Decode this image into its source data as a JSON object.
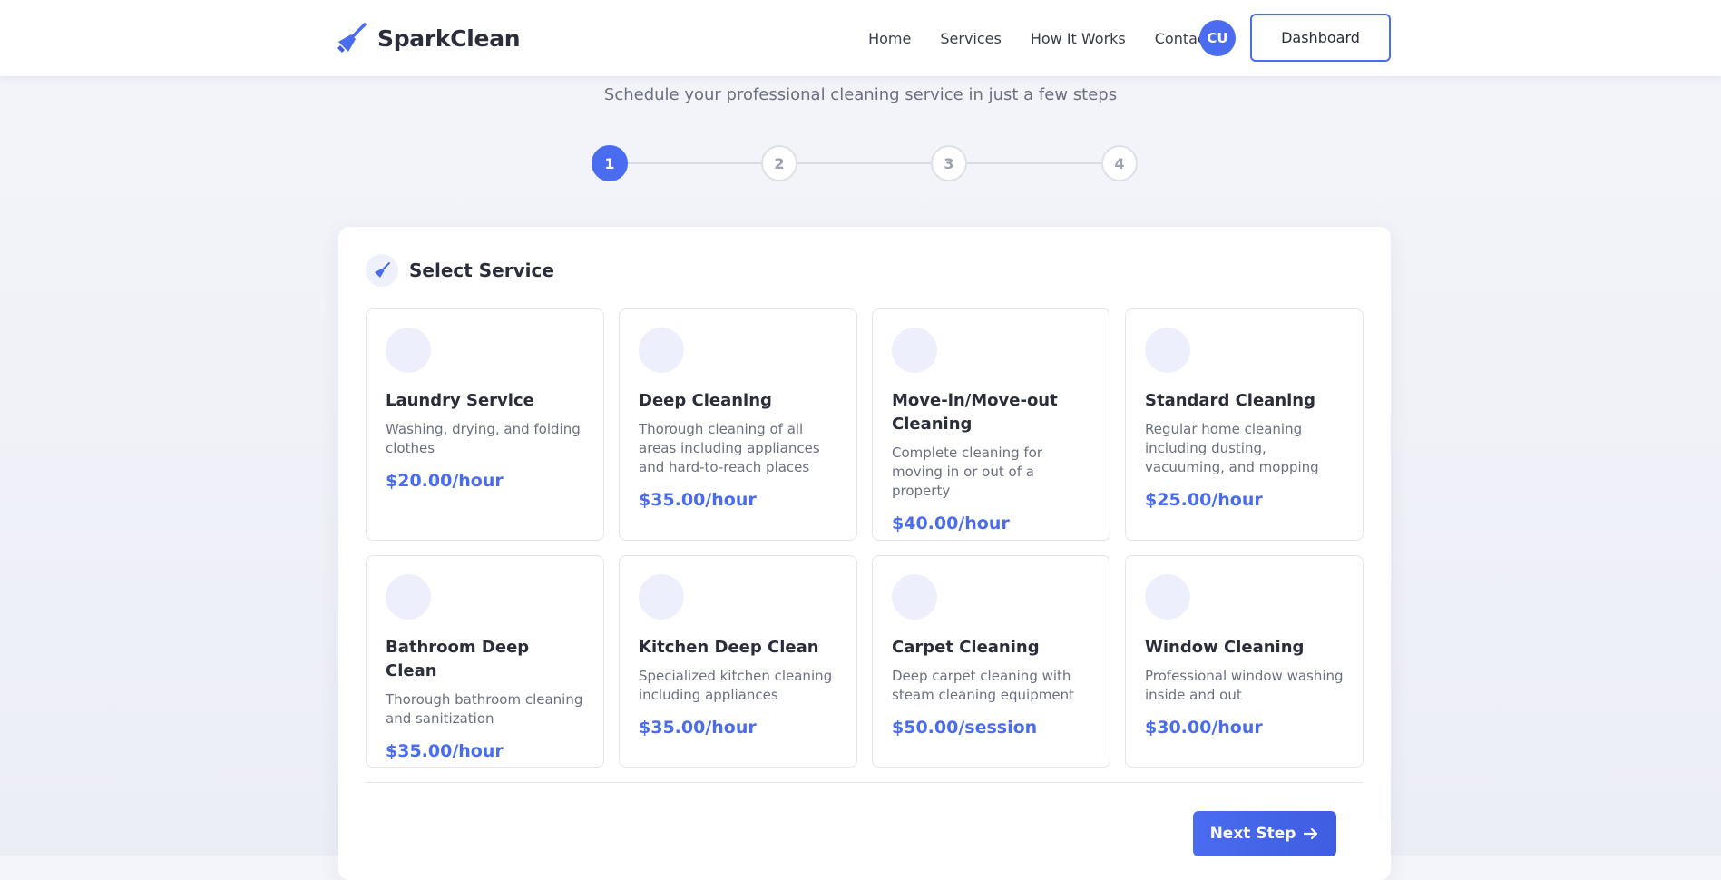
{
  "brand": {
    "name": "SparkClean",
    "icon": "broom-icon",
    "accent": "#4a6cf0"
  },
  "nav": {
    "items": [
      "Home",
      "Services",
      "How It Works",
      "Contact"
    ]
  },
  "user": {
    "initials": "CU"
  },
  "header": {
    "dashboard_label": "Dashboard"
  },
  "subtitle": "Schedule your professional cleaning service in just a few steps",
  "stepper": {
    "steps": [
      "1",
      "2",
      "3",
      "4"
    ],
    "active": 1
  },
  "card": {
    "title": "Select Service",
    "icon": "broom-icon"
  },
  "services": [
    {
      "name": "Laundry Service",
      "description": "Washing, drying, and folding clothes",
      "price": "$20.00/hour"
    },
    {
      "name": "Deep Cleaning",
      "description": "Thorough cleaning of all areas including appliances and hard-to-reach places",
      "price": "$35.00/hour"
    },
    {
      "name": "Move-in/Move-out Cleaning",
      "description": "Complete cleaning for moving in or out of a property",
      "price": "$40.00/hour"
    },
    {
      "name": "Standard Cleaning",
      "description": "Regular home cleaning including dusting, vacuuming, and mopping",
      "price": "$25.00/hour"
    },
    {
      "name": "Bathroom Deep Clean",
      "description": "Thorough bathroom cleaning and sanitization",
      "price": "$35.00/hour"
    },
    {
      "name": "Kitchen Deep Clean",
      "description": "Specialized kitchen cleaning including appliances",
      "price": "$35.00/hour"
    },
    {
      "name": "Carpet Cleaning",
      "description": "Deep carpet cleaning with steam cleaning equipment",
      "price": "$50.00/session"
    },
    {
      "name": "Window Cleaning",
      "description": "Professional window washing inside and out",
      "price": "$30.00/hour"
    }
  ],
  "actions": {
    "next_label": "Next Step",
    "next_icon": "arrow-right-icon"
  }
}
